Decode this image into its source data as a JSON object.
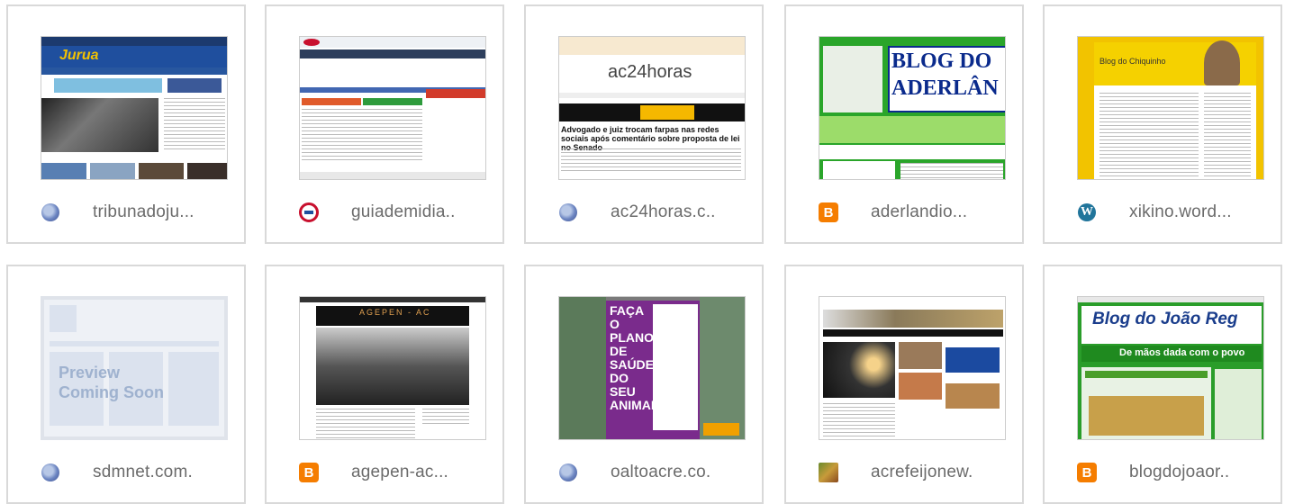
{
  "cards": [
    {
      "domain": "tribunadoju...",
      "favicon": "globe-icon",
      "thumb_title": "Jurua"
    },
    {
      "domain": "guiademidia..",
      "favicon": "guia-icon",
      "thumb_title": ""
    },
    {
      "domain": "ac24horas.c..",
      "favicon": "globe-icon",
      "thumb_title": "ac24horas",
      "headline": "Advogado e juiz trocam farpas nas redes sociais após comentário sobre proposta de lei no Senado"
    },
    {
      "domain": "aderlandio...",
      "favicon": "blogger-icon",
      "thumb_title": "BLOG DO ADERLÂN"
    },
    {
      "domain": "xikino.word...",
      "favicon": "wordpress-icon",
      "thumb_title": "Blog do Chiquinho"
    },
    {
      "domain": "sdmnet.com.",
      "favicon": "globe-icon",
      "thumb_title": "Preview Coming Soon"
    },
    {
      "domain": "agepen-ac...",
      "favicon": "blogger-icon",
      "thumb_title": "AGEPEN - AC"
    },
    {
      "domain": "oaltoacre.co.",
      "favicon": "globe-icon",
      "thumb_title": "FAÇA O PLANO DE SAÚDE DO SEU ANIMAL"
    },
    {
      "domain": "acrefeijonew.",
      "favicon": "photo-icon",
      "thumb_title": ""
    },
    {
      "domain": "blogdojoaor..",
      "favicon": "blogger-icon",
      "thumb_title": "Blog do João Reg",
      "subtitle": "De mãos dada com o povo"
    }
  ]
}
